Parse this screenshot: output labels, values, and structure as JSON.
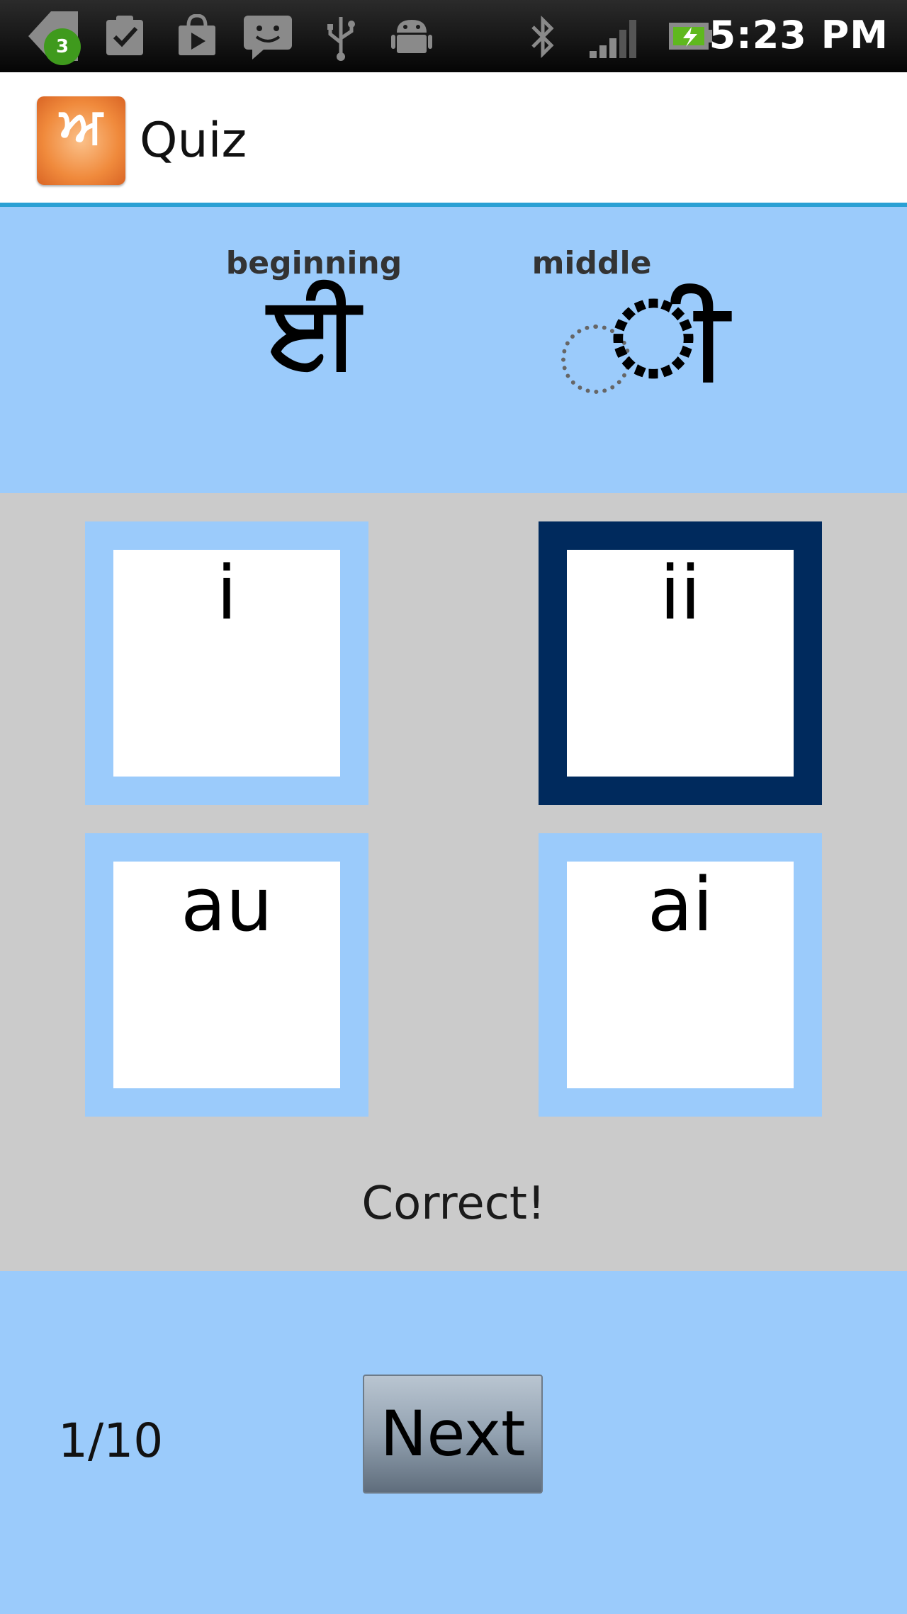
{
  "status_bar": {
    "notification_count": "3",
    "time": "5:23 PM",
    "icons": [
      "notification-back-icon",
      "clipboard-check-icon",
      "shopping-bag-icon",
      "play-store-icon",
      "chat-message-icon",
      "usb-icon",
      "android-icon",
      "bluetooth-icon",
      "signal-strength-icon",
      "battery-charging-icon"
    ]
  },
  "action_bar": {
    "app_icon_text": "ਅ",
    "title": "Quiz"
  },
  "question": {
    "beginning_label": "beginning",
    "beginning_glyph": "ਈ",
    "middle_label": "middle",
    "middle_glyph": "ੀ"
  },
  "options": [
    {
      "label": "i",
      "selected": false
    },
    {
      "label": "ii",
      "selected": true
    },
    {
      "label": "au",
      "selected": false
    },
    {
      "label": "ai",
      "selected": false
    }
  ],
  "feedback": "Correct!",
  "footer": {
    "progress": "1/10",
    "next_label": "Next"
  },
  "colors": {
    "panel_blue": "#9bcbfb",
    "selected_border": "#002a5d",
    "answer_gray": "#cbcbcb",
    "action_bar_divider": "#2aa0d4"
  }
}
